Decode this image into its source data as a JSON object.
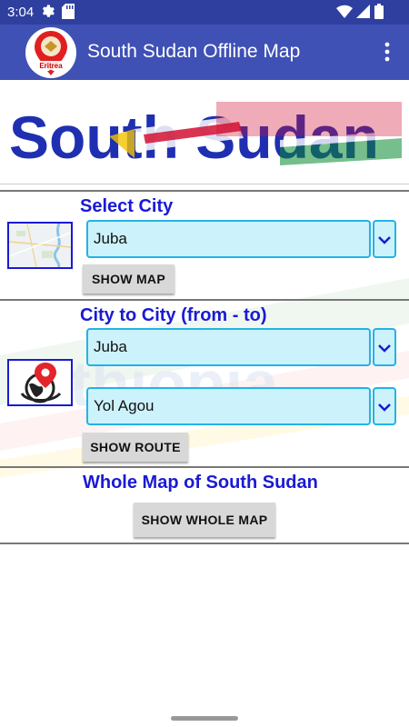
{
  "status_bar": {
    "time": "3:04"
  },
  "app_bar": {
    "title": "South Sudan Offline Map",
    "logo_text": "Eritrea"
  },
  "banner": {
    "text": "South Sudan"
  },
  "select_city": {
    "heading": "Select City",
    "selected": "Juba",
    "button": "SHOW MAP"
  },
  "city_to_city": {
    "heading": "City to City (from - to)",
    "from_selected": "Juba",
    "to_selected": "Yol Agou",
    "button": "SHOW ROUTE"
  },
  "whole_map": {
    "heading": "Whole Map of South Sudan",
    "button": "SHOW WHOLE MAP"
  },
  "colors": {
    "status_bar": "#2f3f9f",
    "app_bar": "#3f51b5",
    "heading_blue": "#1a1ad4",
    "spinner_fill": "#ccf2fb",
    "spinner_border": "#22b3e6",
    "button_gray": "#d8d8d8",
    "flag_red": "#d21034",
    "flag_green": "#078930"
  },
  "icons": [
    "gear-icon",
    "sd-card-icon",
    "wifi-icon",
    "signal-icon",
    "battery-icon",
    "overflow-menu-icon",
    "chevron-down-icon",
    "map-pin-globe-icon",
    "map-thumbnail"
  ]
}
